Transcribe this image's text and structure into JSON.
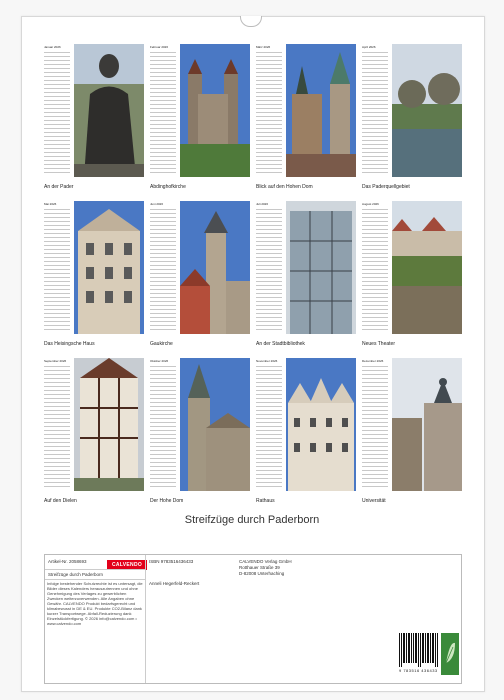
{
  "title": "Streifzüge durch Paderborn",
  "months": [
    {
      "label": "Januar 2026",
      "caption": "An der Pader",
      "photo": "statue"
    },
    {
      "label": "Februar 2026",
      "caption": "Abdinghofkirche",
      "photo": "abdinghof"
    },
    {
      "label": "März 2026",
      "caption": "Blick auf den Hohen Dom",
      "photo": "dom-view"
    },
    {
      "label": "April 2026",
      "caption": "Das Paderquellgebiet",
      "photo": "park"
    },
    {
      "label": "Mai 2026",
      "caption": "Das Heisingsche Haus",
      "photo": "heising"
    },
    {
      "label": "Juni 2026",
      "caption": "Gaukirche",
      "photo": "gaukirche"
    },
    {
      "label": "Juli 2026",
      "caption": "An der Stadtbibliothek",
      "photo": "glass"
    },
    {
      "label": "August 2026",
      "caption": "Neues Theater",
      "photo": "theater"
    },
    {
      "label": "September 2026",
      "caption": "Auf den Dielen",
      "photo": "timber"
    },
    {
      "label": "Oktober 2026",
      "caption": "Der Hohe Dom",
      "photo": "hoher-dom"
    },
    {
      "label": "November 2026",
      "caption": "Rathaus",
      "photo": "rathaus"
    },
    {
      "label": "Dezember 2026",
      "caption": "Universität",
      "photo": "uni"
    }
  ],
  "footer": {
    "article_no": "Artikel-Nr. 2058693",
    "isbn": "ISBN 9783516436433",
    "publisher_name": "CALVENDO Verlag GmbH",
    "publisher_street": "Rotthauer Straße 39",
    "publisher_city": "D-82008 Unterhaching",
    "logo": "CALVENDO",
    "product_title": "Streifzüge durch Paderborn",
    "author": "Anneli Hegerfeld-Reckert",
    "note": "Infolge bestehender Schutzrechte ist es untersagt, die Bilder dieses Kalenders herauszutrennen und ohne Genehmigung des Verlages zu gewerblichen Zwecken weiterzuverwenden. Alle Angaben ohne Gewähr. CALVENDO Produkt bedarfsgerecht und klimabewusst in DE & EU. Produkte CO2-Bilanz dank kurzer Transportwege. Abfall-Reduzierung dank Einzelstückfertigung. © 2026 info@calvendo.com • www.calvendo.com",
    "barcode_number": "9 783516 436433"
  },
  "colors": {
    "sky": "#4a78c4",
    "stone": "#8a7a68",
    "roof": "#6d3a2a",
    "green": "#4f7a3a"
  }
}
